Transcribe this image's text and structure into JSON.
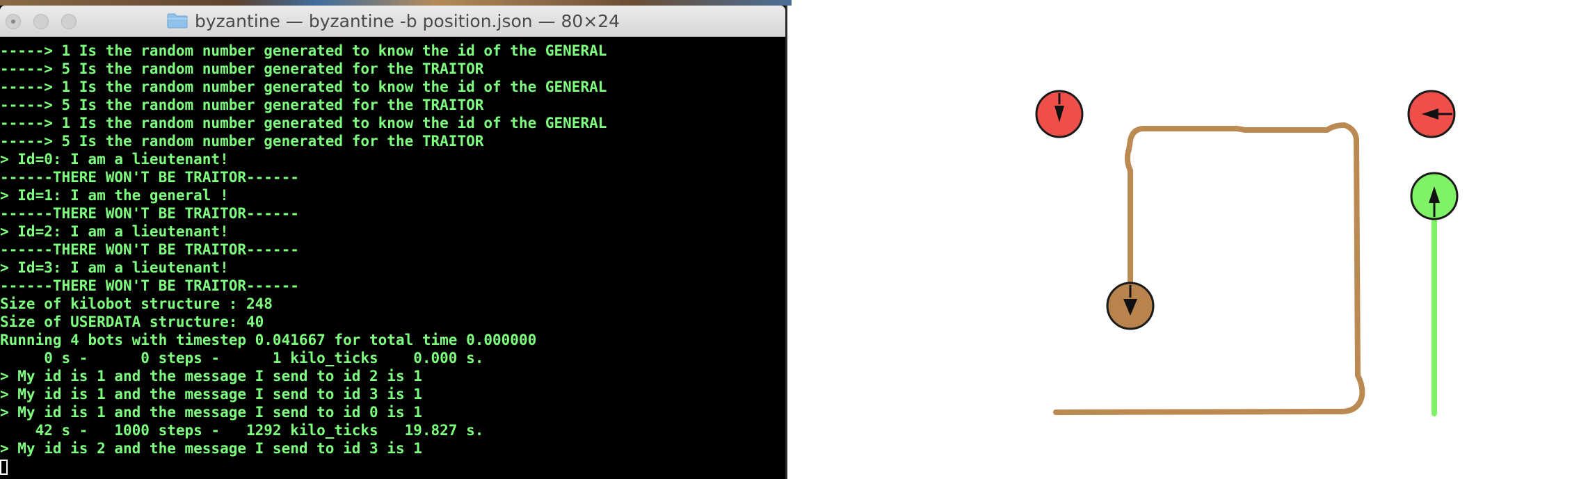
{
  "window": {
    "title": "byzantine — byzantine -b position.json — 80×24"
  },
  "terminal": {
    "lines": [
      "-----> 1 Is the random number generated to know the id of the GENERAL",
      "-----> 5 Is the random number generated for the TRAITOR",
      "-----> 1 Is the random number generated to know the id of the GENERAL",
      "-----> 5 Is the random number generated for the TRAITOR",
      "-----> 1 Is the random number generated to know the id of the GENERAL",
      "-----> 5 Is the random number generated for the TRAITOR",
      "> Id=0: I am a lieutenant!",
      "------THERE WON'T BE TRAITOR------",
      "> Id=1: I am the general !",
      "------THERE WON'T BE TRAITOR------",
      "> Id=2: I am a lieutenant!",
      "------THERE WON'T BE TRAITOR------",
      "> Id=3: I am a lieutenant!",
      "------THERE WON'T BE TRAITOR------",
      "Size of kilobot structure : 248",
      "Size of USERDATA structure: 40",
      "Running 4 bots with timestep 0.041667 for total time 0.000000",
      "     0 s -      0 steps -      1 kilo_ticks    0.000 s.",
      "> My id is 1 and the message I send to id 2 is 1",
      "> My id is 1 and the message I send to id 3 is 1",
      "> My id is 1 and the message I send to id 0 is 1",
      "    42 s -   1000 steps -   1292 kilo_ticks   19.827 s.",
      "> My id is 2 and the message I send to id 3 is 1"
    ]
  },
  "simulation": {
    "colors": {
      "red_bot": "#ef4f4a",
      "green_bot": "#7ff266",
      "brown_bot": "#b8834d",
      "brown_trail": "#bb8a52",
      "green_trail": "#7ff266"
    },
    "bots": [
      {
        "name": "red-bot-1",
        "color": "red_bot",
        "heading": "down"
      },
      {
        "name": "red-bot-2",
        "color": "red_bot",
        "heading": "left"
      },
      {
        "name": "green-bot",
        "color": "green_bot",
        "heading": "up"
      },
      {
        "name": "brown-bot",
        "color": "brown_bot",
        "heading": "down"
      }
    ]
  }
}
